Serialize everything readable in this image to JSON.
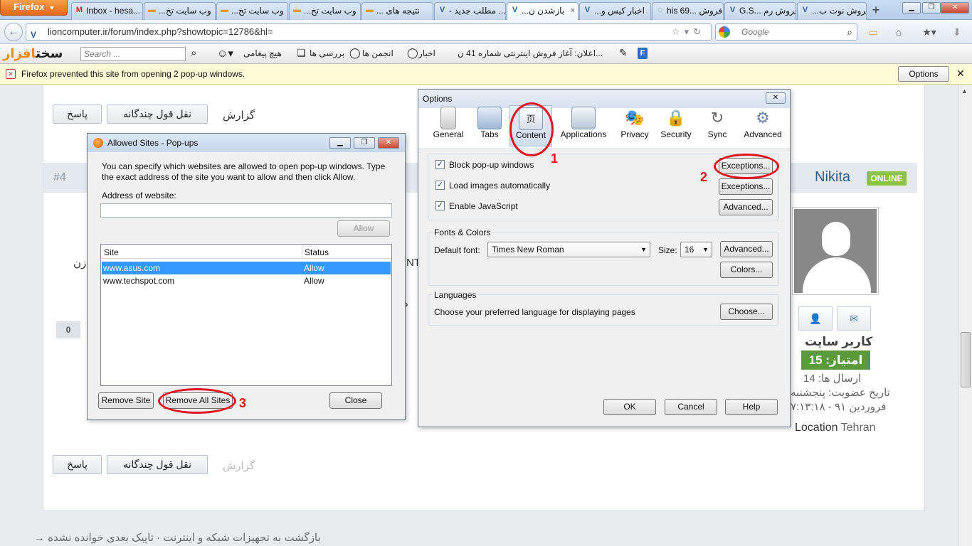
{
  "firefox_button": "Firefox",
  "tabs": [
    {
      "label": "Inbox - hesa...",
      "icon": "gmail-icon"
    },
    {
      "label": "...وب سایت تخ",
      "icon": "dash-icon"
    },
    {
      "label": "...وب سایت تخ",
      "icon": "dash-icon"
    },
    {
      "label": "...وب سایت تخ",
      "icon": "dash-icon"
    },
    {
      "label": "... نتیجه های",
      "icon": "dash-icon"
    },
    {
      "label": "- مطلب جدید ...",
      "icon": "site-icon"
    },
    {
      "label": "...بازشدن ن",
      "icon": "site-icon"
    },
    {
      "label": "...اخبار کیس و",
      "icon": "site-icon"
    },
    {
      "label": "his 69... فروش",
      "icon": "loading-icon"
    },
    {
      "label": "G.S... فروش رم",
      "icon": "site-icon"
    },
    {
      "label": "...فروش نوت ب",
      "icon": "site-icon"
    }
  ],
  "nav": {
    "url": "lioncomputer.ir/forum/index.php?showtopic=12786&hl=",
    "search_placeholder": "Google"
  },
  "site_toolbar": {
    "logo_black": "سخت",
    "logo_orange": "افزار",
    "search_placeholder": "Search ...",
    "messages": "هیچ پیغامی",
    "reviews": "بررسی ها",
    "forums": "انجمن ها",
    "news": "اخبار",
    "announcement": "اعلان: آغاز فروش اینترنتی شماره 41 ن..."
  },
  "notification": {
    "text": "Firefox prevented this site from opening 2 pop-up windows.",
    "options_label": "Options"
  },
  "post": {
    "report": "گزارش",
    "multiquote": "نقل قول چندگانه",
    "reply": "پاسخ",
    "number": "#4",
    "username": "Nikita",
    "status": "ONLINE",
    "role": "کاربر سایت",
    "points": "امتیاز: 15",
    "posts": "ارسال ها: 14",
    "joined_label": "تاریخ عضویت: پنجشنبه",
    "joined_date": "فروردین ۹۱ - ۷:۱۳:۱۸",
    "location_label": "Location",
    "location_value": "Tehran",
    "reputation": "0",
    "frag_left": "زن",
    "frag_mid": "NT",
    "frag_mid2": "ه"
  },
  "footer_link": "بازگشت به تجهیزات شبکه و اینترنت · تاپیک بعدی خوانده نشده →",
  "allowed_sites": {
    "title": "Allowed Sites - Pop-ups",
    "description": "You can specify which websites are allowed to open pop-up windows. Type the exact address of the site you want to allow and then click Allow.",
    "address_label": "Address of website:",
    "allow_button": "Allow",
    "col_site": "Site",
    "col_status": "Status",
    "rows": [
      {
        "site": "www.asus.com",
        "status": "Allow"
      },
      {
        "site": "www.techspot.com",
        "status": "Allow"
      }
    ],
    "remove_site": "Remove Site",
    "remove_all": "Remove All Sites",
    "close": "Close"
  },
  "options": {
    "title": "Options",
    "panes": [
      "General",
      "Tabs",
      "Content",
      "Applications",
      "Privacy",
      "Security",
      "Sync",
      "Advanced"
    ],
    "block_popups": "Block pop-up windows",
    "load_images": "Load images automatically",
    "enable_js": "Enable JavaScript",
    "exceptions1": "Exceptions...",
    "exceptions2": "Exceptions...",
    "advanced_js": "Advanced...",
    "fonts_colors": "Fonts & Colors",
    "default_font_label": "Default font:",
    "default_font": "Times New Roman",
    "size_label": "Size:",
    "size": "16",
    "advanced_fonts": "Advanced...",
    "colors": "Colors...",
    "languages": "Languages",
    "languages_desc": "Choose your preferred language for displaying pages",
    "choose": "Choose...",
    "ok": "OK",
    "cancel": "Cancel",
    "help": "Help"
  },
  "annotations": [
    "1",
    "2",
    "3"
  ],
  "colors": {
    "annotation_red": "#e0141e",
    "firefox_orange": "#e4671b",
    "online_green": "#8bc34a",
    "points_green": "#5a9a3c",
    "selection_blue": "#3399ff"
  }
}
